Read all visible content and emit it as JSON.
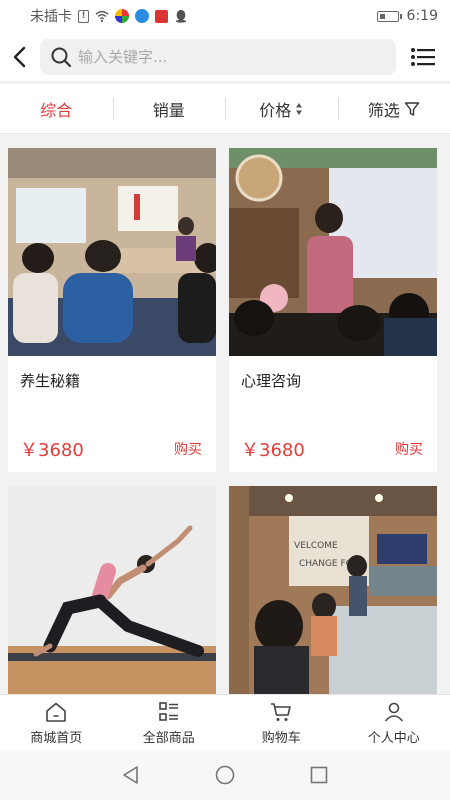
{
  "status_bar": {
    "carrier": "未插卡",
    "time": "6:19",
    "battery_level": 0.35
  },
  "search": {
    "placeholder": "输入关键字..."
  },
  "sort_tabs": [
    {
      "label": "综合",
      "active": true
    },
    {
      "label": "销量",
      "active": false
    },
    {
      "label": "价格",
      "active": false
    },
    {
      "label": "筛选",
      "active": false
    }
  ],
  "products": [
    {
      "title": "养生秘籍",
      "price": "￥3680",
      "buy_label": "购买",
      "image": "classroom-lecture-photo"
    },
    {
      "title": "心理咨询",
      "price": "￥3680",
      "buy_label": "购买",
      "image": "speaker-presentation-photo"
    },
    {
      "title": "",
      "price": "",
      "buy_label": "",
      "image": "yoga-pose-photo"
    },
    {
      "title": "",
      "price": "",
      "buy_label": "",
      "image": "group-meeting-photo"
    }
  ],
  "bottom_nav": [
    {
      "label": "商城首页",
      "icon": "home-icon"
    },
    {
      "label": "全部商品",
      "icon": "grid-list-icon"
    },
    {
      "label": "购物车",
      "icon": "cart-icon"
    },
    {
      "label": "个人中心",
      "icon": "user-icon"
    }
  ],
  "colors": {
    "accent": "#e63b3b",
    "text": "#333333",
    "background": "#f2f2f2"
  },
  "system_nav": [
    {
      "icon": "back-triangle-icon"
    },
    {
      "icon": "home-circle-icon"
    },
    {
      "icon": "recents-square-icon"
    }
  ]
}
